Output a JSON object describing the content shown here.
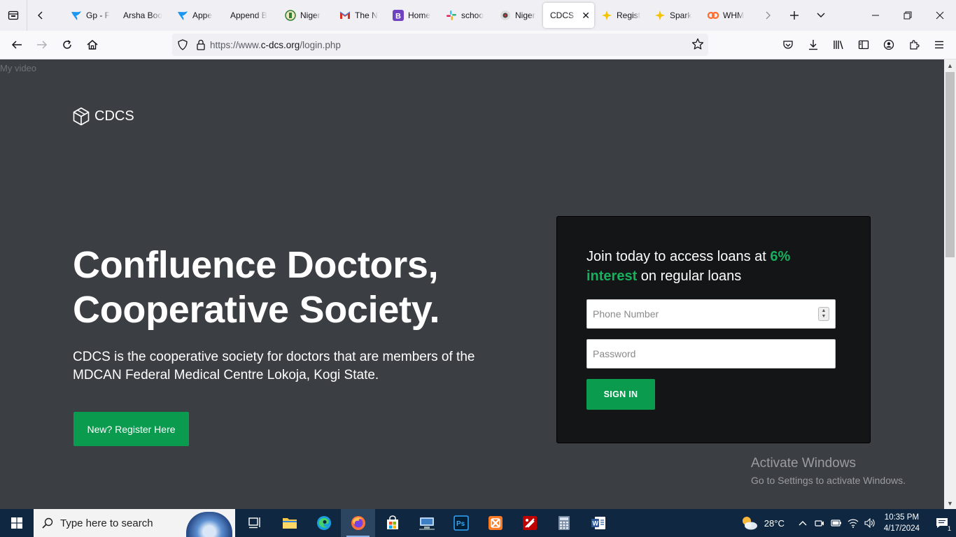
{
  "browser": {
    "tabs": [
      {
        "title": "Gp - F",
        "favicon": "bird-icon",
        "color": "#1a96f0"
      },
      {
        "title": "Arsha Boo",
        "favicon": "none",
        "color": ""
      },
      {
        "title": "Appe",
        "favicon": "bird-icon",
        "color": "#1a96f0"
      },
      {
        "title": "Append B",
        "favicon": "none",
        "color": ""
      },
      {
        "title": "Niger",
        "favicon": "seal-icon",
        "color": "#2e7d32"
      },
      {
        "title": "The N",
        "favicon": "gmail-icon",
        "color": "#d93025"
      },
      {
        "title": "Home",
        "favicon": "bootstrap-icon",
        "color": "#6f42c1"
      },
      {
        "title": "schoo",
        "favicon": "slack-icon",
        "color": "#e01e5a"
      },
      {
        "title": "Niger",
        "favicon": "eye-icon",
        "color": "#444"
      },
      {
        "title": "CDCS L",
        "favicon": "none",
        "color": "",
        "active": true
      },
      {
        "title": "Regist",
        "favicon": "spark-icon",
        "color": "#f5c400"
      },
      {
        "title": "Spark",
        "favicon": "spark-icon",
        "color": "#f5c400"
      },
      {
        "title": "WHM",
        "favicon": "cp-icon",
        "color": "#ff6c2c"
      }
    ],
    "url_prefix": "https://www.",
    "url_domain": "c-dcs.org",
    "url_path": "/login.php"
  },
  "page": {
    "overlay_label": "My video",
    "logo_text": "CDCS",
    "hero_title_line1": "Confluence Doctors,",
    "hero_title_line2": "Cooperative Society.",
    "hero_desc": "CDCS is the cooperative society for doctors that are members of the MDCAN Federal Medical Centre Lokoja, Kogi State.",
    "register_button": "New? Register Here",
    "card": {
      "head_part1": "Join today to access loans at ",
      "head_highlight": "6% interest",
      "head_part2": " on regular loans",
      "phone_placeholder": "Phone Number",
      "password_placeholder": "Password",
      "signin_button": "SIGN IN"
    },
    "activate_title": "Activate Windows",
    "activate_sub": "Go to Settings to activate Windows."
  },
  "taskbar": {
    "search_placeholder": "Type here to search",
    "temperature": "28°C",
    "time": "10:35 PM",
    "date": "4/17/2024",
    "notifications": "1"
  },
  "colors": {
    "accent_green": "#0a9b4f",
    "highlight_green": "#17b05c",
    "page_bg": "#3b3e42",
    "card_bg": "#141516",
    "taskbar_bg": "#0f2740"
  }
}
